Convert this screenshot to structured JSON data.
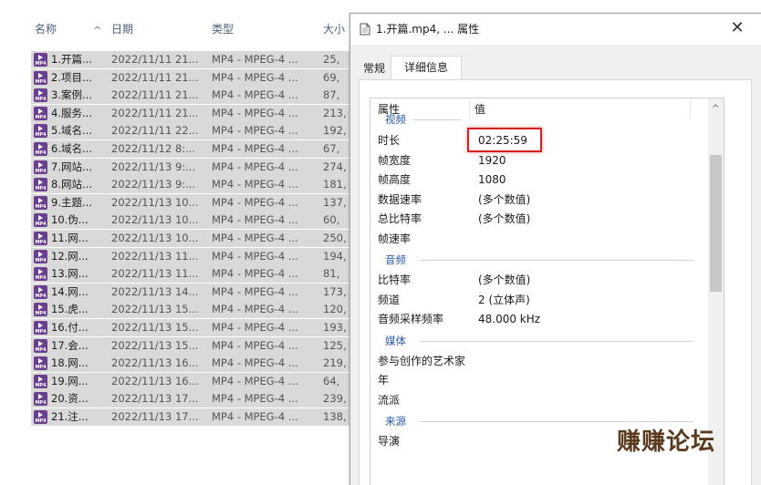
{
  "explorer": {
    "columns": {
      "name": "名称",
      "date": "日期",
      "type": "类型",
      "size": "大小"
    },
    "sort_indicator": "^",
    "file_icon_tag": "MP4",
    "files": [
      {
        "name": "1.开篇...",
        "date": "2022/11/11 21...",
        "type": "MP4 - MPEG-4 ...",
        "size": "25,"
      },
      {
        "name": "2.项目...",
        "date": "2022/11/11 21...",
        "type": "MP4 - MPEG-4 ...",
        "size": "69,"
      },
      {
        "name": "3.案例...",
        "date": "2022/11/11 21...",
        "type": "MP4 - MPEG-4 ...",
        "size": "87,"
      },
      {
        "name": "4.服务...",
        "date": "2022/11/11 21...",
        "type": "MP4 - MPEG-4 ...",
        "size": "213,"
      },
      {
        "name": "5.域名...",
        "date": "2022/11/11 22...",
        "type": "MP4 - MPEG-4 ...",
        "size": "192,"
      },
      {
        "name": "6.域名...",
        "date": "2022/11/12 8:...",
        "type": "MP4 - MPEG-4 ...",
        "size": "67,"
      },
      {
        "name": "7.网站...",
        "date": "2022/11/13 9:...",
        "type": "MP4 - MPEG-4 ...",
        "size": "274,"
      },
      {
        "name": "8.网站...",
        "date": "2022/11/13 9:...",
        "type": "MP4 - MPEG-4 ...",
        "size": "181,"
      },
      {
        "name": "9.主题...",
        "date": "2022/11/13 10...",
        "type": "MP4 - MPEG-4 ...",
        "size": "137,"
      },
      {
        "name": "10.伪...",
        "date": "2022/11/13 10...",
        "type": "MP4 - MPEG-4 ...",
        "size": "60,"
      },
      {
        "name": "11.网...",
        "date": "2022/11/13 10...",
        "type": "MP4 - MPEG-4 ...",
        "size": "250,"
      },
      {
        "name": "12.网...",
        "date": "2022/11/13 11...",
        "type": "MP4 - MPEG-4 ...",
        "size": "194,"
      },
      {
        "name": "13.网...",
        "date": "2022/11/13 11...",
        "type": "MP4 - MPEG-4 ...",
        "size": "81,"
      },
      {
        "name": "14.网...",
        "date": "2022/11/13 14...",
        "type": "MP4 - MPEG-4 ...",
        "size": "173,"
      },
      {
        "name": "15.虎...",
        "date": "2022/11/13 15...",
        "type": "MP4 - MPEG-4 ...",
        "size": "120,"
      },
      {
        "name": "16.付...",
        "date": "2022/11/13 15...",
        "type": "MP4 - MPEG-4 ...",
        "size": "193,"
      },
      {
        "name": "17.会...",
        "date": "2022/11/13 15...",
        "type": "MP4 - MPEG-4 ...",
        "size": "125,"
      },
      {
        "name": "18.网...",
        "date": "2022/11/13 16...",
        "type": "MP4 - MPEG-4 ...",
        "size": "219,"
      },
      {
        "name": "19.网...",
        "date": "2022/11/13 16...",
        "type": "MP4 - MPEG-4 ...",
        "size": "64,"
      },
      {
        "name": "20.资...",
        "date": "2022/11/13 17...",
        "type": "MP4 - MPEG-4 ...",
        "size": "239,"
      },
      {
        "name": "21.注...",
        "date": "2022/11/13 17...",
        "type": "MP4 - MPEG-4 ...",
        "size": "138,"
      }
    ]
  },
  "dialog": {
    "title": "1.开篇.mp4, ... 属性",
    "close_glyph": "✕",
    "tabs": {
      "general": "常规",
      "details": "详细信息"
    },
    "header": {
      "property": "属性",
      "value": "值"
    },
    "groups": {
      "video": "视频",
      "audio": "音频",
      "media": "媒体",
      "origin": "来源"
    },
    "video_props": [
      {
        "name": "时长",
        "value": "02:25:59"
      },
      {
        "name": "帧宽度",
        "value": "1920"
      },
      {
        "name": "帧高度",
        "value": "1080"
      },
      {
        "name": "数据速率",
        "value": "(多个数值)"
      },
      {
        "name": "总比特率",
        "value": "(多个数值)"
      },
      {
        "name": "帧速率",
        "value": ""
      }
    ],
    "audio_props": [
      {
        "name": "比特率",
        "value": "(多个数值)"
      },
      {
        "name": "频道",
        "value": "2 (立体声)"
      },
      {
        "name": "音频采样频率",
        "value": "48.000 kHz"
      }
    ],
    "media_props": [
      {
        "name": "参与创作的艺术家",
        "value": ""
      },
      {
        "name": "年",
        "value": ""
      },
      {
        "name": "流派",
        "value": ""
      }
    ],
    "origin_props": [
      {
        "name": "导演",
        "value": ""
      }
    ],
    "scroll_up_glyph": "^"
  },
  "watermark": "赚赚论坛",
  "colors": {
    "highlight": "#d42020",
    "group_text": "#2a5aa8",
    "row_bg": "#d9d9d9",
    "file_icon": "#6a3f8f"
  }
}
